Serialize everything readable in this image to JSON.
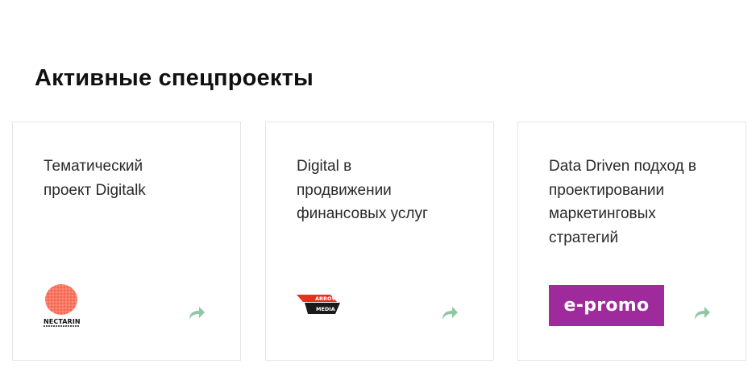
{
  "section": {
    "title": "Активные спецпроекты"
  },
  "cards": [
    {
      "lines": [
        "Тематический",
        "проект Digitalk"
      ],
      "logo": {
        "name": "NECTARIN"
      }
    },
    {
      "lines": [
        "Digital в",
        "продвижении",
        "финансовых услуг"
      ],
      "logo": {
        "line1": "ARROW",
        "line2": "MEDIA"
      }
    },
    {
      "lines": [
        "Data Driven подход в",
        "проектировании",
        "маркетинговых",
        "стратегий"
      ],
      "logo": {
        "name": "e-promo"
      }
    }
  ],
  "colors": {
    "arrow_icon": "#8fc6a3",
    "epromo_bg": "#9e2a9c",
    "nectarin_orange": "#f2664f",
    "arrow_media_red": "#e8301e"
  },
  "icons": {
    "card_arrow": "share-arrow-icon"
  }
}
